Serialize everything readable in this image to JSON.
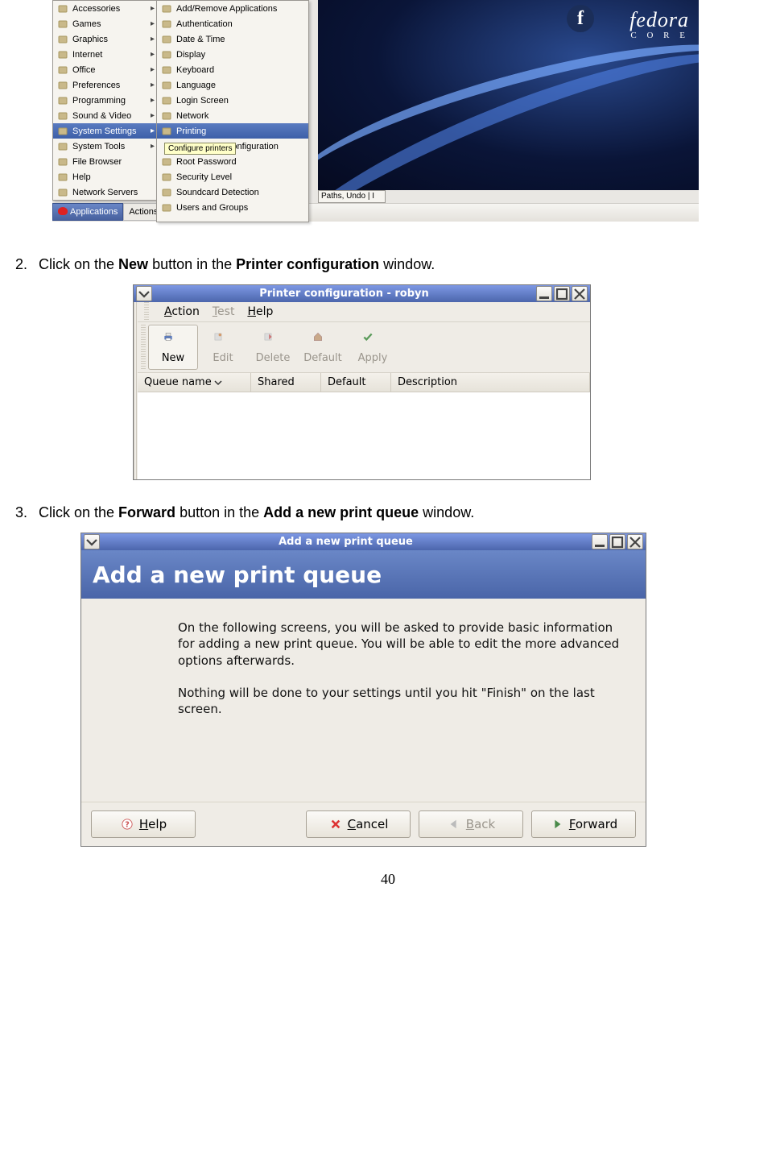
{
  "shot1": {
    "brand": "fedora",
    "brand_sub": "C O R E",
    "panel": {
      "applications": "Applications",
      "actions": "Actions"
    },
    "tooltip": "Configure printers",
    "status_tip": "Paths, Undo | I",
    "menu1": [
      {
        "label": "Accessories",
        "arrow": true,
        "name": "menu-accessories"
      },
      {
        "label": "Games",
        "arrow": true,
        "name": "menu-games"
      },
      {
        "label": "Graphics",
        "arrow": true,
        "name": "menu-graphics"
      },
      {
        "label": "Internet",
        "arrow": true,
        "name": "menu-internet"
      },
      {
        "label": "Office",
        "arrow": true,
        "name": "menu-office"
      },
      {
        "label": "Preferences",
        "arrow": true,
        "name": "menu-preferences"
      },
      {
        "label": "Programming",
        "arrow": true,
        "name": "menu-programming"
      },
      {
        "label": "Sound & Video",
        "arrow": true,
        "name": "menu-sound-video"
      },
      {
        "label": "System Settings",
        "arrow": true,
        "sel": true,
        "name": "menu-system-settings"
      },
      {
        "label": "System Tools",
        "arrow": true,
        "name": "menu-system-tools"
      },
      {
        "label": "File Browser",
        "arrow": false,
        "name": "menu-file-browser"
      },
      {
        "label": "Help",
        "arrow": false,
        "name": "menu-help"
      },
      {
        "label": "Network Servers",
        "arrow": false,
        "name": "menu-network-servers"
      }
    ],
    "menu2": [
      {
        "label": "Add/Remove Applications",
        "name": "ss-add-remove"
      },
      {
        "label": "Authentication",
        "name": "ss-authentication"
      },
      {
        "label": "Date & Time",
        "name": "ss-date-time"
      },
      {
        "label": "Display",
        "name": "ss-display"
      },
      {
        "label": "Keyboard",
        "name": "ss-keyboard"
      },
      {
        "label": "Language",
        "name": "ss-language"
      },
      {
        "label": "Login Screen",
        "name": "ss-login-screen"
      },
      {
        "label": "Network",
        "name": "ss-network"
      },
      {
        "label": "Printing",
        "sel": true,
        "name": "ss-printing"
      },
      {
        "label": "etwork Configuration",
        "name": "ss-network-config",
        "indent": true
      },
      {
        "label": "Root Password",
        "name": "ss-root-password"
      },
      {
        "label": "Security Level",
        "name": "ss-security-level"
      },
      {
        "label": "Soundcard Detection",
        "name": "ss-soundcard"
      },
      {
        "label": "Users and Groups",
        "name": "ss-users-groups"
      }
    ]
  },
  "instr2": {
    "num": "2.",
    "pre": "Click on the ",
    "b1": "New",
    "mid": " button in the ",
    "b2": "Printer configuration",
    "post": " window."
  },
  "shot2": {
    "title": "Printer configuration - robyn",
    "menu": {
      "action_u": "A",
      "action_rest": "ction",
      "test_u": "T",
      "test_rest": "est",
      "help_u": "H",
      "help_rest": "elp"
    },
    "toolbar": {
      "new": "New",
      "edit": "Edit",
      "delete": "Delete",
      "default": "Default",
      "apply": "Apply"
    },
    "headers": {
      "queue": "Queue name",
      "shared": "Shared",
      "default": "Default",
      "desc": "Description"
    }
  },
  "instr3": {
    "num": "3.",
    "pre": "Click on the ",
    "b1": "Forward",
    "mid": " button in the ",
    "b2": "Add a new print queue",
    "post": " window."
  },
  "shot3": {
    "title": "Add a new print queue",
    "banner": "Add a new print queue",
    "para1": "On the following screens, you will be asked to provide basic information for adding a new print queue.  You will be able to edit the more advanced options afterwards.",
    "para2": "Nothing will be done to your settings until you hit \"Finish\" on the last screen.",
    "buttons": {
      "help_u": "H",
      "help_rest": "elp",
      "cancel_u": "C",
      "cancel_rest": "ancel",
      "back_u": "B",
      "back_rest": "ack",
      "forward_u": "F",
      "forward_rest": "orward"
    }
  },
  "pagenum": "40"
}
